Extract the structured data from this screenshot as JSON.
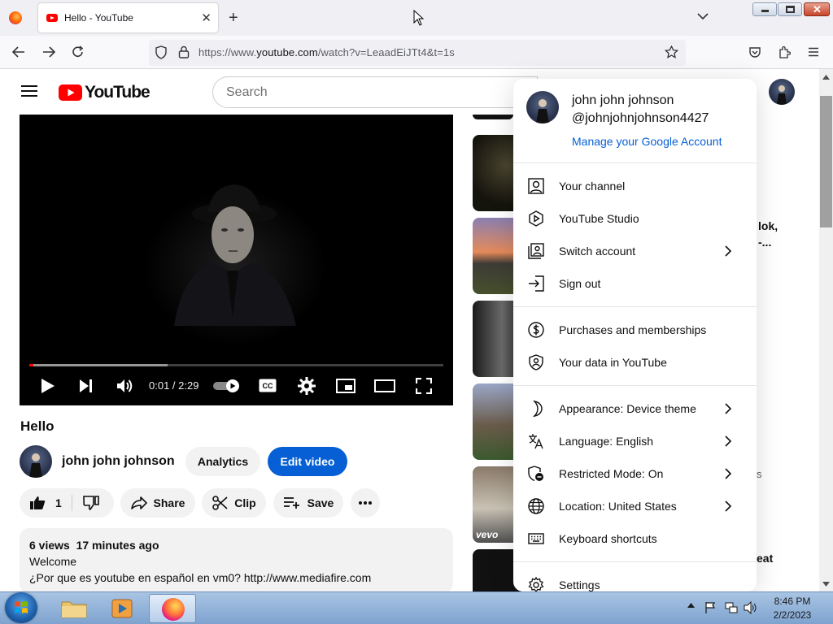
{
  "browser": {
    "tab_title": "Hello - YouTube",
    "url_prefix": "https://www.",
    "url_host": "youtube.com",
    "url_path": "/watch?v=LeaadEiJTt4&t=1s"
  },
  "youtube": {
    "logo_text": "YouTube",
    "search_placeholder": "Search"
  },
  "player": {
    "time": "0:01 / 2:29",
    "progress_fraction": 0.01
  },
  "video": {
    "title": "Hello",
    "channel_name": "john john johnson",
    "analytics_label": "Analytics",
    "edit_label": "Edit video",
    "like_count": "1",
    "share_label": "Share",
    "clip_label": "Clip",
    "save_label": "Save",
    "desc_stats": "6 views  17 minutes ago",
    "desc_line1": "Welcome",
    "desc_line2": "¿Por que es youtube en español en vm0? http://www.mediafire.com"
  },
  "sidebar": {
    "partial_1": "lok,",
    "partial_2": "-...",
    "partial_3": "eat",
    "partial_4": "s",
    "vevo": "vevo"
  },
  "account_menu": {
    "name": "john john johnson",
    "handle": "@johnjohnjohnson4427",
    "manage": "Manage your Google Account",
    "items": [
      {
        "label": "Your channel",
        "icon": "person-icon"
      },
      {
        "label": "YouTube Studio",
        "icon": "studio-icon"
      },
      {
        "label": "Switch account",
        "icon": "switch-account-icon"
      },
      {
        "label": "Sign out",
        "icon": "sign-out-icon"
      },
      {
        "label": "Purchases and memberships",
        "icon": "dollar-icon"
      },
      {
        "label": "Your data in YouTube",
        "icon": "shield-person-icon"
      },
      {
        "label": "Appearance: Device theme",
        "icon": "moon-icon"
      },
      {
        "label": "Language: English",
        "icon": "translate-icon"
      },
      {
        "label": "Restricted Mode: On",
        "icon": "restricted-icon"
      },
      {
        "label": "Location: United States",
        "icon": "globe-icon"
      },
      {
        "label": "Keyboard shortcuts",
        "icon": "keyboard-icon"
      },
      {
        "label": "Settings",
        "icon": "gear-icon"
      }
    ]
  },
  "taskbar": {
    "time": "8:46 PM",
    "date": "2/2/2023"
  },
  "colors": {
    "youtube_red": "#ff0000",
    "link_blue": "#065fd4"
  }
}
